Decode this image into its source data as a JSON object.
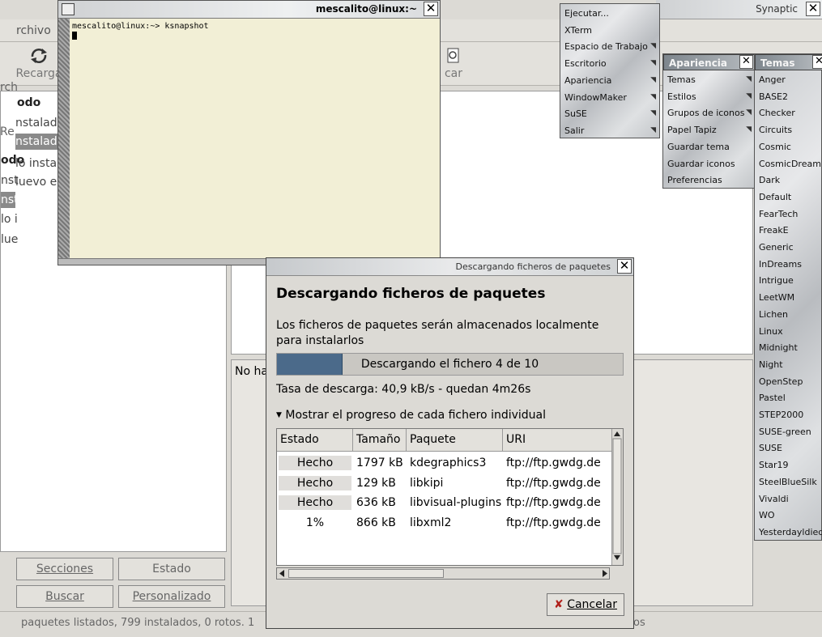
{
  "synaptic": {
    "window_title": "Synaptic",
    "menu_archivo": "rchivo",
    "toolbar_recargar": "Recarga",
    "toolbar_buscar": "car",
    "left_items": [
      "odo",
      "nstalados",
      "nstalados",
      "odo",
      "lo instal",
      "nst",
      "luevo e",
      "nst",
      "lo i",
      "lue"
    ],
    "left_left_fragments": [
      "rch",
      "Re"
    ],
    "nohay": "No ha",
    "btn_secciones": "Secciones",
    "btn_estado": "Estado",
    "btn_buscar": "Buscar",
    "btn_personalizado": "Personalizado",
    "status": "paquetes listados, 799 instalados, 0 rotos. 1",
    "status_tail": "os"
  },
  "terminal": {
    "title": "mescalito@linux:~",
    "prompt": "mescalito@linux:~> ksnapshot"
  },
  "wm_root_menu": {
    "items": [
      "Ejecutar...",
      "XTerm",
      "Espacio de Trabajo",
      "Escritorio",
      "Apariencia",
      "WindowMaker",
      "SuSE",
      "Salir"
    ],
    "has_submenu": [
      false,
      false,
      true,
      true,
      true,
      true,
      true,
      true
    ]
  },
  "wm_apariencia_menu": {
    "title": "Apariencia",
    "items": [
      "Temas",
      "Estilos",
      "Grupos de iconos",
      "Papel Tapiz",
      "Guardar tema",
      "Guardar iconos",
      "Preferencias"
    ],
    "has_submenu": [
      true,
      true,
      true,
      true,
      false,
      false,
      false
    ]
  },
  "wm_temas_menu": {
    "title": "Temas",
    "items": [
      "Anger",
      "BASE2",
      "Checker",
      "Circuits",
      "Cosmic",
      "CosmicDream",
      "Dark",
      "Default",
      "FearTech",
      "FreakE",
      "Generic",
      "InDreams",
      "Intrigue",
      "LeetWM",
      "Lichen",
      "Linux",
      "Midnight",
      "Night",
      "OpenStep",
      "Pastel",
      "STEP2000",
      "SUSE-green",
      "SUSE",
      "Star19",
      "SteelBlueSilk",
      "Vivaldi",
      "WO",
      "Yesterdayldied"
    ]
  },
  "dialog": {
    "title": "Descargando ficheros de paquetes",
    "heading": "Descargando ficheros de paquetes",
    "description": "Los ficheros de paquetes serán almacenados localmente para instalarlos",
    "progress_text": "Descargando el fichero 4 de 10",
    "progress_fraction": 0.19,
    "rate": "Tasa de descarga: 40,9 kB/s - quedan 4m26s",
    "expander": "Mostrar el progreso de cada fichero individual",
    "columns": [
      "Estado",
      "Tamaño",
      "Paquete",
      "URI"
    ],
    "rows": [
      {
        "estado": "Hecho",
        "tamano": "1797 kB",
        "paquete": "kdegraphics3",
        "uri": "ftp://ftp.gwdg.de"
      },
      {
        "estado": "Hecho",
        "tamano": "129 kB",
        "paquete": "libkipi",
        "uri": "ftp://ftp.gwdg.de"
      },
      {
        "estado": "Hecho",
        "tamano": "636 kB",
        "paquete": "libvisual-plugins",
        "uri": "ftp://ftp.gwdg.de"
      },
      {
        "estado": "1%",
        "tamano": "866 kB",
        "paquete": "libxml2",
        "uri": "ftp://ftp.gwdg.de"
      }
    ],
    "cancel_label": "Cancelar"
  }
}
